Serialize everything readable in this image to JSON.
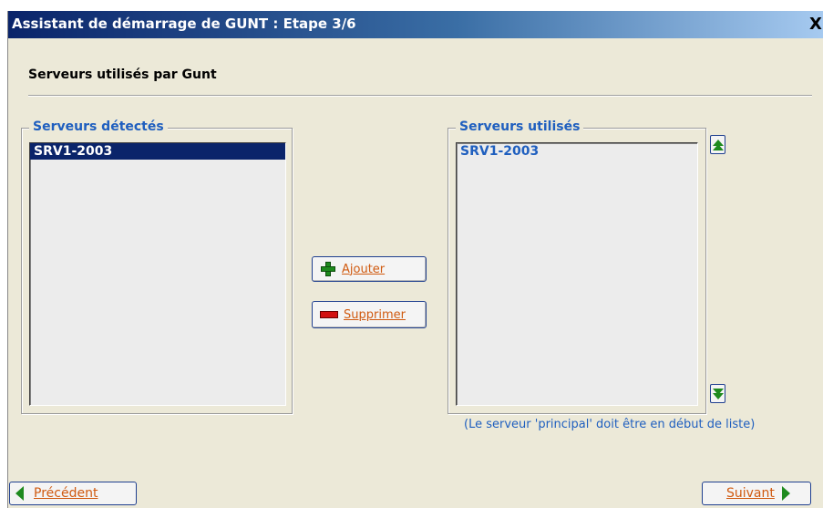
{
  "window": {
    "title": "Assistant de démarrage de GUNT : Etape 3/6",
    "close_label": "X"
  },
  "section": {
    "title": "Serveurs utilisés par Gunt"
  },
  "detected": {
    "legend": "Serveurs détectés",
    "items": [
      {
        "label": "SRV1-2003",
        "selected": true
      }
    ]
  },
  "used": {
    "legend": "Serveurs utilisés",
    "items": [
      {
        "label": "SRV1-2003",
        "selected": false
      }
    ]
  },
  "buttons": {
    "add_label": "Ajouter",
    "remove_label": "Supprimer",
    "move_up_icon": "move-up-icon",
    "move_down_icon": "move-down-icon"
  },
  "hint": "(Le serveur 'principal' doit être en début de liste)",
  "nav": {
    "previous_label": "Précédent",
    "next_label": "Suivant"
  },
  "colors": {
    "title_gradient_start": "#0a246a",
    "accent_blue": "#1f5fbf",
    "button_text": "#d05a10",
    "arrow_green": "#1e8a1e",
    "selection": "#0a246a"
  }
}
